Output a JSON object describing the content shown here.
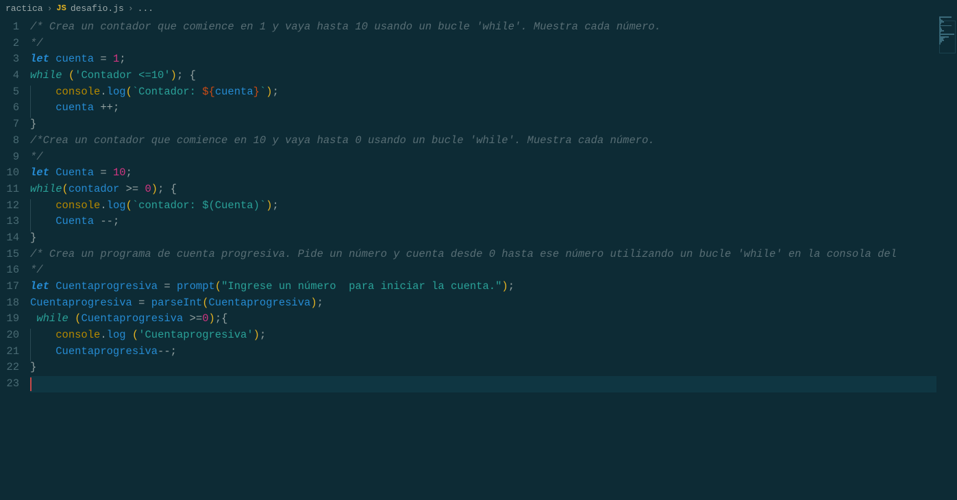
{
  "breadcrumb": {
    "folder": "ractica",
    "file": "desafio.js",
    "rest": "..."
  },
  "lines": [
    {
      "n": 1,
      "tokens": [
        {
          "t": "/* Crea un contador que comience en 1 y vaya hasta 10 usando un bucle 'while'. Muestra cada número.",
          "c": "c-comment"
        }
      ]
    },
    {
      "n": 2,
      "tokens": [
        {
          "t": "*/",
          "c": "c-comment"
        }
      ]
    },
    {
      "n": 3,
      "tokens": [
        {
          "t": "let",
          "c": "c-decl"
        },
        {
          "t": " "
        },
        {
          "t": "cuenta",
          "c": "c-var"
        },
        {
          "t": " "
        },
        {
          "t": "=",
          "c": "c-op"
        },
        {
          "t": " "
        },
        {
          "t": "1",
          "c": "c-num"
        },
        {
          "t": ";",
          "c": "c-punc"
        }
      ]
    },
    {
      "n": 4,
      "tokens": [
        {
          "t": "while",
          "c": "c-kw"
        },
        {
          "t": " "
        },
        {
          "t": "(",
          "c": "c-paren"
        },
        {
          "t": "'Contador <=10'",
          "c": "c-str"
        },
        {
          "t": ")",
          "c": "c-paren"
        },
        {
          "t": ";",
          "c": "c-punc"
        },
        {
          "t": " "
        },
        {
          "t": "{",
          "c": "c-punc"
        }
      ]
    },
    {
      "n": 5,
      "indent": 1,
      "tokens": [
        {
          "t": "    "
        },
        {
          "t": "console",
          "c": "c-obj"
        },
        {
          "t": ".",
          "c": "c-punc"
        },
        {
          "t": "log",
          "c": "c-fn"
        },
        {
          "t": "(",
          "c": "c-paren"
        },
        {
          "t": "`Contador: ",
          "c": "c-str"
        },
        {
          "t": "${",
          "c": "c-tpl"
        },
        {
          "t": "cuenta",
          "c": "c-var"
        },
        {
          "t": "}",
          "c": "c-tpl"
        },
        {
          "t": "`",
          "c": "c-str"
        },
        {
          "t": ")",
          "c": "c-paren"
        },
        {
          "t": ";",
          "c": "c-punc"
        }
      ]
    },
    {
      "n": 6,
      "indent": 1,
      "tokens": [
        {
          "t": "    "
        },
        {
          "t": "cuenta",
          "c": "c-var"
        },
        {
          "t": " "
        },
        {
          "t": "++",
          "c": "c-op"
        },
        {
          "t": ";",
          "c": "c-punc"
        }
      ]
    },
    {
      "n": 7,
      "tokens": [
        {
          "t": "}",
          "c": "c-punc"
        }
      ]
    },
    {
      "n": 8,
      "tokens": [
        {
          "t": "/*Crea un contador que comience en 10 y vaya hasta 0 usando un bucle 'while'. Muestra cada número.",
          "c": "c-comment"
        }
      ]
    },
    {
      "n": 9,
      "tokens": [
        {
          "t": "*/",
          "c": "c-comment"
        }
      ]
    },
    {
      "n": 10,
      "tokens": [
        {
          "t": "let",
          "c": "c-decl"
        },
        {
          "t": " "
        },
        {
          "t": "Cuenta",
          "c": "c-var"
        },
        {
          "t": " "
        },
        {
          "t": "=",
          "c": "c-op"
        },
        {
          "t": " "
        },
        {
          "t": "10",
          "c": "c-num"
        },
        {
          "t": ";",
          "c": "c-punc"
        }
      ]
    },
    {
      "n": 11,
      "tokens": [
        {
          "t": "while",
          "c": "c-kw"
        },
        {
          "t": "(",
          "c": "c-paren"
        },
        {
          "t": "contador",
          "c": "c-var"
        },
        {
          "t": " "
        },
        {
          "t": ">=",
          "c": "c-op"
        },
        {
          "t": " "
        },
        {
          "t": "0",
          "c": "c-num"
        },
        {
          "t": ")",
          "c": "c-paren"
        },
        {
          "t": ";",
          "c": "c-punc"
        },
        {
          "t": " "
        },
        {
          "t": "{",
          "c": "c-punc"
        }
      ]
    },
    {
      "n": 12,
      "indent": 1,
      "tokens": [
        {
          "t": "    "
        },
        {
          "t": "console",
          "c": "c-obj"
        },
        {
          "t": ".",
          "c": "c-punc"
        },
        {
          "t": "log",
          "c": "c-fn"
        },
        {
          "t": "(",
          "c": "c-paren"
        },
        {
          "t": "`contador: $(Cuenta)`",
          "c": "c-str"
        },
        {
          "t": ")",
          "c": "c-paren"
        },
        {
          "t": ";",
          "c": "c-punc"
        }
      ]
    },
    {
      "n": 13,
      "indent": 1,
      "tokens": [
        {
          "t": "    "
        },
        {
          "t": "Cuenta",
          "c": "c-var"
        },
        {
          "t": " "
        },
        {
          "t": "--",
          "c": "c-op"
        },
        {
          "t": ";",
          "c": "c-punc"
        }
      ]
    },
    {
      "n": 14,
      "tokens": [
        {
          "t": "}",
          "c": "c-punc"
        }
      ]
    },
    {
      "n": 15,
      "tokens": [
        {
          "t": "/* Crea un programa de cuenta progresiva. Pide un número y cuenta desde 0 hasta ese número utilizando un bucle 'while' en la consola del ",
          "c": "c-comment"
        }
      ]
    },
    {
      "n": 16,
      "tokens": [
        {
          "t": "*/",
          "c": "c-comment"
        }
      ]
    },
    {
      "n": 17,
      "tokens": [
        {
          "t": "let",
          "c": "c-decl"
        },
        {
          "t": " "
        },
        {
          "t": "Cuentaprogresiva",
          "c": "c-var"
        },
        {
          "t": " "
        },
        {
          "t": "=",
          "c": "c-op"
        },
        {
          "t": " "
        },
        {
          "t": "prompt",
          "c": "c-fn"
        },
        {
          "t": "(",
          "c": "c-paren"
        },
        {
          "t": "\"Ingrese un número  para iniciar la cuenta.\"",
          "c": "c-str"
        },
        {
          "t": ")",
          "c": "c-paren"
        },
        {
          "t": ";",
          "c": "c-punc"
        }
      ]
    },
    {
      "n": 18,
      "tokens": [
        {
          "t": "Cuentaprogresiva",
          "c": "c-var"
        },
        {
          "t": " "
        },
        {
          "t": "=",
          "c": "c-op"
        },
        {
          "t": " "
        },
        {
          "t": "parseInt",
          "c": "c-fn"
        },
        {
          "t": "(",
          "c": "c-paren"
        },
        {
          "t": "Cuentaprogresiva",
          "c": "c-var"
        },
        {
          "t": ")",
          "c": "c-paren"
        },
        {
          "t": ";",
          "c": "c-punc"
        }
      ]
    },
    {
      "n": 19,
      "indent": 0,
      "tokens": [
        {
          "t": " "
        },
        {
          "t": "while",
          "c": "c-kw"
        },
        {
          "t": " "
        },
        {
          "t": "(",
          "c": "c-paren"
        },
        {
          "t": "Cuentaprogresiva",
          "c": "c-var"
        },
        {
          "t": " "
        },
        {
          "t": ">=",
          "c": "c-op"
        },
        {
          "t": "0",
          "c": "c-num"
        },
        {
          "t": ")",
          "c": "c-paren"
        },
        {
          "t": ";",
          "c": "c-punc"
        },
        {
          "t": "{",
          "c": "c-punc"
        }
      ]
    },
    {
      "n": 20,
      "indent": 1,
      "tokens": [
        {
          "t": "    "
        },
        {
          "t": "console",
          "c": "c-obj"
        },
        {
          "t": ".",
          "c": "c-punc"
        },
        {
          "t": "log",
          "c": "c-fn"
        },
        {
          "t": " "
        },
        {
          "t": "(",
          "c": "c-paren"
        },
        {
          "t": "'Cuentaprogresiva'",
          "c": "c-str"
        },
        {
          "t": ")",
          "c": "c-paren"
        },
        {
          "t": ";",
          "c": "c-punc"
        }
      ]
    },
    {
      "n": 21,
      "indent": 1,
      "tokens": [
        {
          "t": "    "
        },
        {
          "t": "Cuentaprogresiva",
          "c": "c-var"
        },
        {
          "t": "--",
          "c": "c-op"
        },
        {
          "t": ";",
          "c": "c-punc"
        }
      ]
    },
    {
      "n": 22,
      "tokens": [
        {
          "t": "}",
          "c": "c-punc"
        }
      ]
    },
    {
      "n": 23,
      "cursor": true,
      "highlight": true,
      "tokens": []
    }
  ]
}
